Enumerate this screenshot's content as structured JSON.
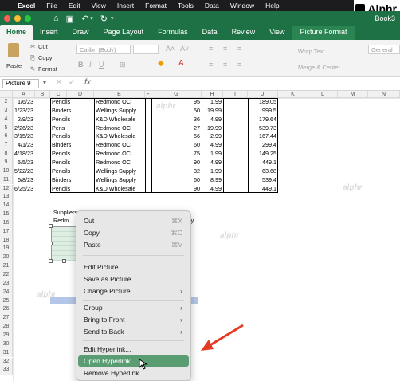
{
  "macbar": {
    "app": "Excel",
    "menus": [
      "File",
      "Edit",
      "View",
      "Insert",
      "Format",
      "Tools",
      "Data",
      "Window",
      "Help"
    ]
  },
  "brand": "Alphr",
  "window": {
    "title": "Book3"
  },
  "ribbon_tabs": [
    "Home",
    "Insert",
    "Draw",
    "Page Layout",
    "Formulas",
    "Data",
    "Review",
    "View",
    "Picture Format"
  ],
  "ribbon": {
    "paste": "Paste",
    "cut": "Cut",
    "copy": "Copy",
    "format": "Format",
    "font": "Calibri (Body)",
    "wrap": "Wrap Text",
    "merge": "Merge & Center",
    "number": "General"
  },
  "namebox": "Picture 9",
  "fx": "fx",
  "columns": [
    "A",
    "B",
    "C",
    "D",
    "E",
    "F",
    "G",
    "H",
    "I",
    "J",
    "K",
    "L",
    "M",
    "N"
  ],
  "rows": [
    "2",
    "3",
    "4",
    "5",
    "6",
    "7",
    "8",
    "9",
    "10",
    "11",
    "12",
    "13",
    "14",
    "15",
    "16",
    "17",
    "18",
    "19",
    "20",
    "21",
    "22",
    "23",
    "24",
    "25",
    "26",
    "27",
    "28",
    "29",
    "30",
    "31",
    "32",
    "33"
  ],
  "table": [
    [
      "1/6/23",
      "Pencils",
      "Redmond OC",
      "95",
      "1.99",
      "189.05"
    ],
    [
      "1/23/23",
      "Binders",
      "Wellings Supply",
      "50",
      "19.99",
      "999.5"
    ],
    [
      "2/9/23",
      "Pencils",
      "K&D Wholesale",
      "36",
      "4.99",
      "179.64"
    ],
    [
      "2/26/23",
      "Pens",
      "Redmond OC",
      "27",
      "19.99",
      "539.73"
    ],
    [
      "3/15/23",
      "Pencils",
      "K&D Wholesale",
      "56",
      "2.99",
      "167.44"
    ],
    [
      "4/1/23",
      "Binders",
      "Redmond OC",
      "60",
      "4.99",
      "299.4"
    ],
    [
      "4/18/23",
      "Pencils",
      "Redmond OC",
      "75",
      "1.99",
      "149.25"
    ],
    [
      "5/5/23",
      "Pencils",
      "Redmond OC",
      "90",
      "4.99",
      "449.1"
    ],
    [
      "5/22/23",
      "Pencils",
      "Wellings Supply",
      "32",
      "1.99",
      "63.68"
    ],
    [
      "6/8/23",
      "Binders",
      "Wellings Supply",
      "60",
      "8.99",
      "539.4"
    ],
    [
      "6/25/23",
      "Pencils",
      "K&D Wholesale",
      "90",
      "4.99",
      "449.1"
    ]
  ],
  "suppliers": {
    "header": "Suppliers",
    "row1": "Redm",
    "tail": "ly"
  },
  "context_menu": [
    {
      "label": "Cut",
      "shortcut": "⌘X"
    },
    {
      "label": "Copy",
      "shortcut": "⌘C"
    },
    {
      "label": "Paste",
      "shortcut": "⌘V"
    },
    {
      "label": "Edit Picture"
    },
    {
      "label": "Save as Picture..."
    },
    {
      "label": "Change Picture"
    },
    {
      "label": "Group"
    },
    {
      "label": "Bring to Front"
    },
    {
      "label": "Send to Back"
    },
    {
      "label": "Edit Hyperlink..."
    },
    {
      "label": "Open Hyperlink"
    },
    {
      "label": "Remove Hyperlink"
    }
  ],
  "watermark": "alphr",
  "colors": {
    "accent": "#1e7145",
    "highlight": "#5a9d72",
    "arrow": "#e53b24"
  }
}
